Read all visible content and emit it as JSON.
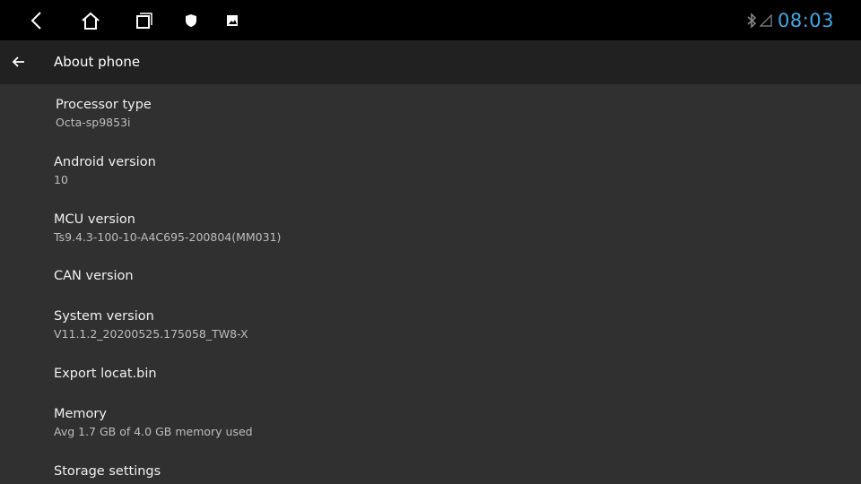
{
  "statusbar": {
    "time": "08:03",
    "icons": [
      "back-icon",
      "home-icon",
      "recents-icon",
      "shield-icon",
      "gallery-icon",
      "bluetooth-icon",
      "signal-icon"
    ]
  },
  "appbar": {
    "title": "About phone"
  },
  "items": [
    {
      "label": "Processor type",
      "value": "Octa-sp9853i"
    },
    {
      "label": "Android version",
      "value": "10"
    },
    {
      "label": "MCU version",
      "value": "Ts9.4.3-100-10-A4C695-200804(MM031)"
    },
    {
      "label": "CAN version",
      "value": ""
    },
    {
      "label": "System version",
      "value": "V11.1.2_20200525.175058_TW8-X"
    },
    {
      "label": "Export locat.bin",
      "value": ""
    },
    {
      "label": "Memory",
      "value": "Avg 1.7 GB of 4.0 GB memory used"
    },
    {
      "label": "Storage settings",
      "value": ""
    }
  ],
  "colors": {
    "accent": "#3fa9e6",
    "statusbar_bg": "#000000",
    "appbar_bg": "#212121",
    "content_bg": "#303030"
  }
}
